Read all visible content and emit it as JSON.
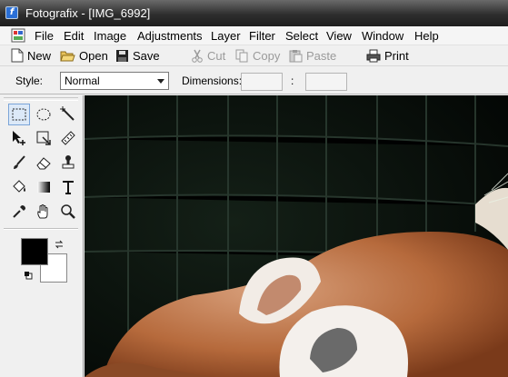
{
  "window": {
    "title": "Fotografix - [IMG_6992]",
    "app_icon_glyph": "f"
  },
  "menubar": {
    "items": [
      "File",
      "Edit",
      "Image",
      "Adjustments",
      "Layer",
      "Filter",
      "Select",
      "View",
      "Window",
      "Help"
    ]
  },
  "toolbar": {
    "new": "New",
    "open": "Open",
    "save": "Save",
    "cut": "Cut",
    "copy": "Copy",
    "paste": "Paste",
    "print": "Print"
  },
  "options": {
    "style_label": "Style:",
    "style_value": "Normal",
    "dimensions_label": "Dimensions:",
    "separator": ":"
  },
  "tools": [
    "rectangle-select",
    "ellipse-select",
    "magic-wand",
    "move",
    "crop",
    "measure",
    "brush",
    "eraser",
    "clone-stamp",
    "fill-bucket",
    "gradient",
    "text",
    "eyedropper",
    "hand",
    "zoom"
  ],
  "colors": {
    "foreground": "#000000",
    "background": "#ffffff",
    "selection_highlight": "#dce9f8"
  },
  "canvas": {
    "image_subject": "red panda photograph"
  }
}
